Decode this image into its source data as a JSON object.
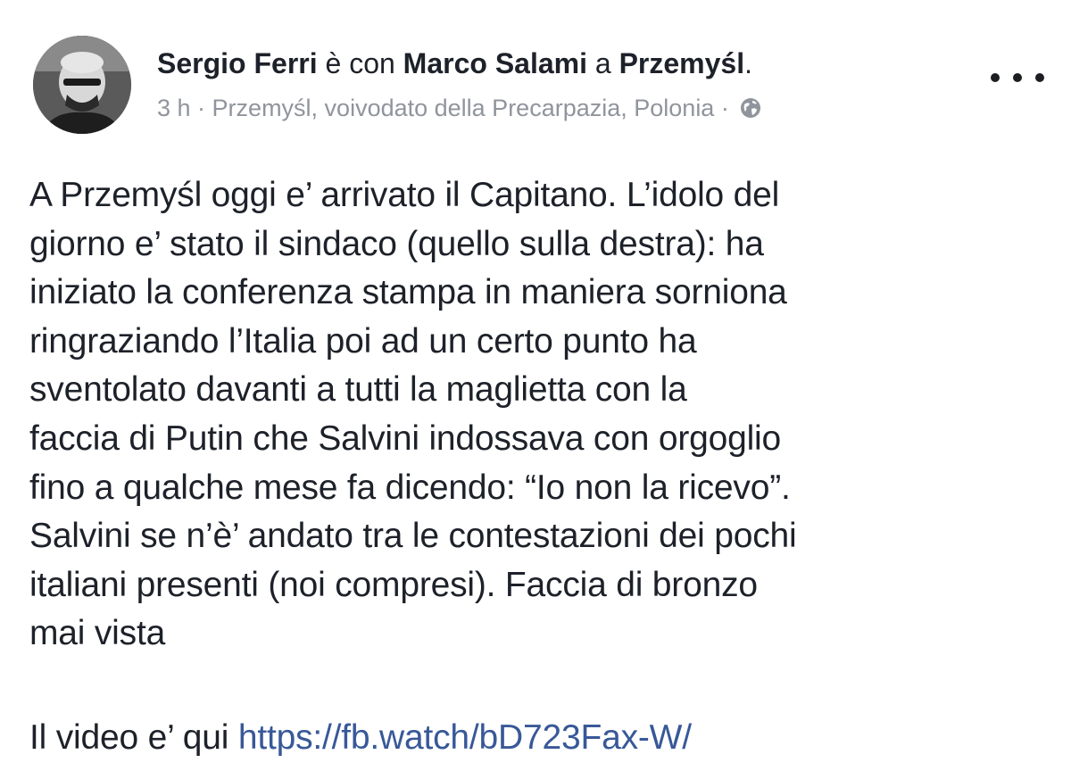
{
  "header": {
    "author": "Sergio Ferri",
    "with_word": " è con ",
    "tagged": "Marco Salami",
    "at_word": " a ",
    "place": "Przemyśl",
    "end": "."
  },
  "meta": {
    "time": "3 h",
    "separator": " · ",
    "location": "Przemyśl, voivodato della Precarpazia, Polonia",
    "separator2": " · ",
    "privacy_icon": "globe-icon"
  },
  "post": {
    "lines": [
      "A Przemyśl oggi e’ arrivato il Capitano. L’idolo del",
      "giorno e’ stato il sindaco (quello sulla destra): ha",
      "iniziato la conferenza stampa in maniera sorniona",
      "ringraziando l’Italia poi ad un certo punto ha",
      "sventolato davanti a tutti la maglietta con la",
      "faccia di Putin che Salvini indossava con orgoglio",
      "fino a qualche mese fa dicendo: “Io non la ricevo”.",
      "Salvini se n’è’ andato tra le contestazioni dei pochi",
      "italiani presenti (noi compresi). Faccia di bronzo",
      "mai vista"
    ],
    "video_prefix": "Il video e’ qui ",
    "video_link": "https://fb.watch/bD723Fax-W/"
  },
  "colors": {
    "link": "#385898",
    "meta": "#90949c",
    "text": "#1d2129"
  }
}
